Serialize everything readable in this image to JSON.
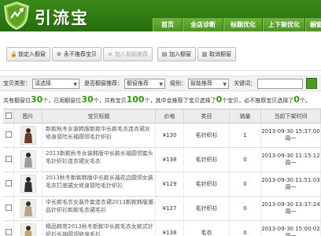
{
  "app": {
    "logo_text": "引流宝",
    "nav": [
      "首页",
      "全店诊断",
      "标题优化",
      "上下架优化",
      "橱窗"
    ]
  },
  "toolbar": {
    "buttons": [
      {
        "label": "锁定入橱窗",
        "icon": "lock-icon",
        "disabled": false
      },
      {
        "label": "永不推荐宝贝",
        "icon": "no-entry-icon",
        "disabled": false
      },
      {
        "label": "加入智能推荐",
        "icon": "add-smart-icon",
        "disabled": true
      },
      {
        "label": "加入橱窗",
        "icon": "add-window-icon",
        "disabled": false
      },
      {
        "label": "取消橱窗",
        "icon": "cancel-window-icon",
        "disabled": false
      }
    ]
  },
  "filter": {
    "type_label": "宝贝类型：",
    "type_value": "请选择",
    "recommend_label": "是否橱窗推荐：",
    "recommend_value": "橱窗推荐",
    "level_label": "级别：",
    "level_value": "智能推荐",
    "keyword_label": "关键词：",
    "keyword_value": ""
  },
  "stats": {
    "p1": "共有橱窗位",
    "total_slots": "30",
    "p2": "个，已用橱窗位",
    "used_slots": "30",
    "p3": "个，共有宝贝",
    "total_items": "100",
    "p4": "个，其中会推荐了宝贝选择了",
    "recommended": "0",
    "p5": "个宝贝，必不推荐宝贝选择了",
    "never_recommend": "0",
    "p6": "个。"
  },
  "table": {
    "headers": [
      "",
      "图片",
      "宝贝标题",
      "价格",
      "类目",
      "销量",
      "当前下架时间"
    ],
    "rows": [
      {
        "title": "新款秋冬女装韩版新款中长款毛衣连衣裙女修身冒险长袖圆领毛针织衫",
        "price": "¥130",
        "category": "毛针织衫",
        "sales": "1",
        "date": "2013-09-30 15:37:00",
        "weekday": "周一"
      },
      {
        "title": "2013新款秋冬女装韩版中长款长袖圆领套头毛针织衫连衣裙女毛衣",
        "price": "¥138",
        "category": "毛针织衫",
        "sales": "0",
        "date": "2013-09-30 11:15:12",
        "weekday": "周一"
      },
      {
        "title": "2013秋冬新款韩版中长款长袖花边圆领女装毛衣打底裙女修身冒险毛针织衫",
        "price": "¥129",
        "category": "毛针织衫",
        "sales": "0",
        "date": "2013-09-30 11:51:03",
        "weekday": "周一"
      },
      {
        "title": "中长款毛衣女装外套连衣裙2013新款韩版潮品针织衫新款毛衣裙毛衫",
        "price": "¥127",
        "category": "毛针织衫",
        "sales": "0",
        "date": "2013-09-30 13:37:24",
        "weekday": "周一"
      },
      {
        "title": "精品韩帝2013秋冬新款中长款毛衣女款式针织衫长袖圆领修身毛衫",
        "price": "¥138",
        "category": "毛衣",
        "sales": "0",
        "date": "2013-09-30 15:00:02",
        "weekday": "周一"
      }
    ]
  },
  "colors": {
    "brand_green": "#2e7a12",
    "accent_green": "#3e8f14",
    "price_color": "#333333"
  }
}
